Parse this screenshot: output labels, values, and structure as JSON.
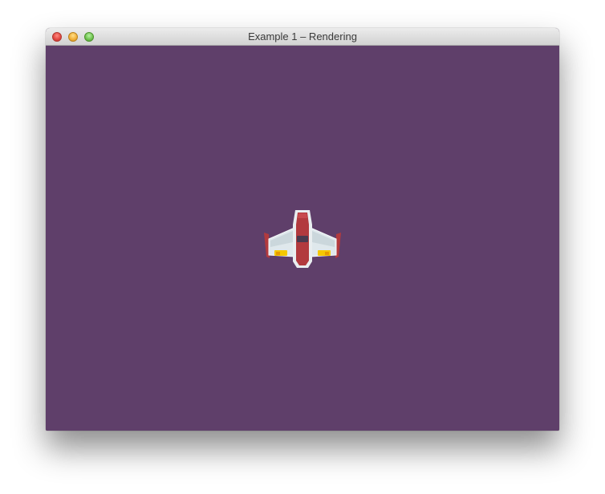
{
  "window": {
    "title": "Example 1 – Rendering"
  },
  "scene": {
    "background_color": "#5f3f6a",
    "sprite": "spaceship-sprite"
  },
  "colors": {
    "ship_red": "#b23a3e",
    "ship_white": "#e9eef0",
    "ship_glass": "#4a3a4f",
    "ship_yellow": "#f5c800"
  }
}
